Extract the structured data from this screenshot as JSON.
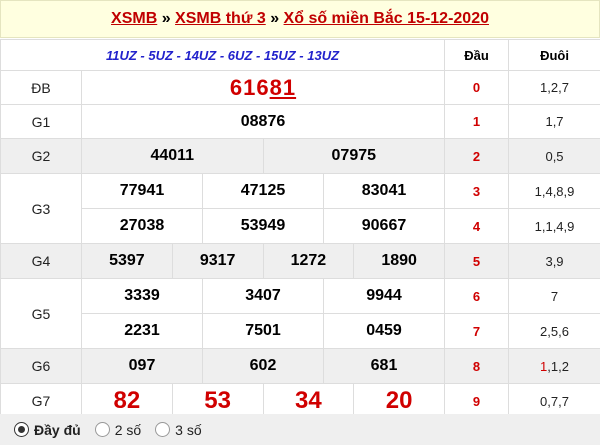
{
  "title": {
    "link1": "XSMB",
    "sep1": " » ",
    "link2": "XSMB thứ 3",
    "sep2": " » ",
    "link3": "Xổ số miền Bắc 15-12-2020"
  },
  "header": {
    "codes": "11UZ - 5UZ - 14UZ - 6UZ - 15UZ - 13UZ",
    "dau_label": "Đầu",
    "duoi_label": "Đuôi"
  },
  "prizes": {
    "db": {
      "label": "ĐB",
      "num_prefix": "616",
      "num_suffix": "81"
    },
    "g1": {
      "label": "G1",
      "nums": [
        "08876"
      ]
    },
    "g2": {
      "label": "G2",
      "nums": [
        "44011",
        "07975"
      ]
    },
    "g3": {
      "label": "G3",
      "nums": [
        "77941",
        "47125",
        "83041",
        "27038",
        "53949",
        "90667"
      ]
    },
    "g4": {
      "label": "G4",
      "nums": [
        "5397",
        "9317",
        "1272",
        "1890"
      ]
    },
    "g5": {
      "label": "G5",
      "nums": [
        "3339",
        "3407",
        "9944",
        "2231",
        "7501",
        "0459"
      ]
    },
    "g6": {
      "label": "G6",
      "nums": [
        "097",
        "602",
        "681"
      ]
    },
    "g7": {
      "label": "G7",
      "nums": [
        "82",
        "53",
        "34",
        "20"
      ]
    }
  },
  "loto": [
    {
      "dau": "0",
      "duoi": "1,2,7"
    },
    {
      "dau": "1",
      "duoi": "1,7"
    },
    {
      "dau": "2",
      "duoi": "0,5"
    },
    {
      "dau": "3",
      "duoi": "1,4,8,9"
    },
    {
      "dau": "4",
      "duoi": "1,1,4,9"
    },
    {
      "dau": "5",
      "duoi": "3,9"
    },
    {
      "dau": "6",
      "duoi": "7"
    },
    {
      "dau": "7",
      "duoi": "2,5,6"
    },
    {
      "dau": "8",
      "duoi_red": "1",
      "duoi_rest": ",1,2"
    },
    {
      "dau": "9",
      "duoi": "0,7,7"
    }
  ],
  "footer": {
    "opt1": "Đầy đủ",
    "opt2": "2 số",
    "opt3": "3 số",
    "selected": "Đầy đủ"
  },
  "colors": {
    "red": "#d00000",
    "blue": "#2222cc",
    "title_bg": "#ffffe0",
    "alt_row": "#efefef"
  }
}
